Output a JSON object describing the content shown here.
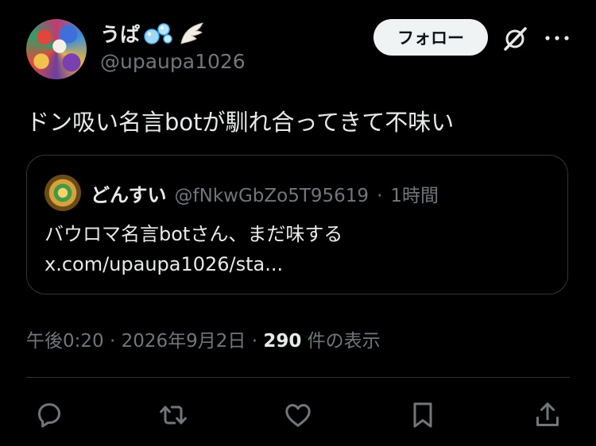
{
  "author": {
    "display_name": "うぱ",
    "handle": "@upaupa1026"
  },
  "header": {
    "follow_label": "フォロー"
  },
  "tweet": {
    "text": "ドン吸い名言botが馴れ合ってきて不味い"
  },
  "quote": {
    "display_name": "どんすい",
    "handle": "@fNkwGbZo5T95619",
    "separator": "·",
    "time": "1時間",
    "line1": "バウロマ名言botさん、まだ味する",
    "line2": "x.com/upaupa1026/sta..."
  },
  "meta": {
    "time": "午後0:20",
    "sep1": "·",
    "date": "2026年9月2日",
    "sep2": "·",
    "views_count": "290",
    "views_label": "件の表示"
  },
  "actions": {
    "icons": [
      "reply-icon",
      "retweet-icon",
      "like-icon",
      "bookmark-icon",
      "share-icon"
    ]
  },
  "colors": {
    "background": "#000000",
    "primary_text": "#e7e9ea",
    "secondary_text": "#71767b",
    "border": "#333639",
    "follow_bg": "#eff3f4"
  }
}
